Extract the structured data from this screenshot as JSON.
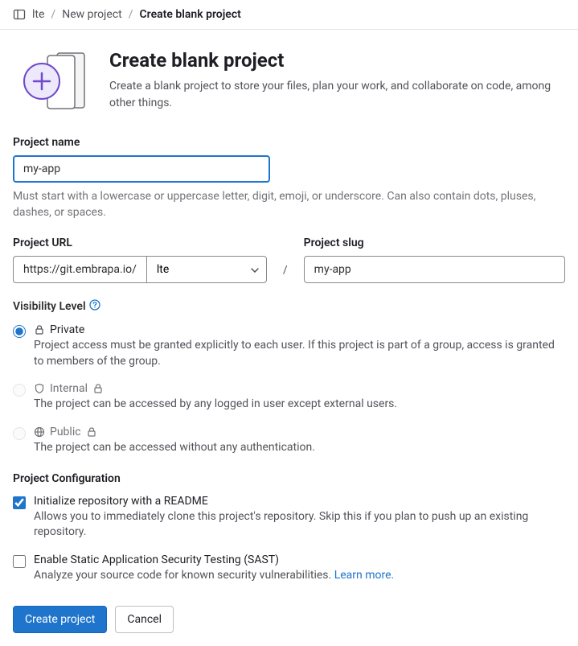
{
  "breadcrumb": {
    "items": [
      "lte",
      "New project",
      "Create blank project"
    ]
  },
  "header": {
    "title": "Create blank project",
    "description": "Create a blank project to store your files, plan your work, and collaborate on code, among other things."
  },
  "form": {
    "project_name": {
      "label": "Project name",
      "value": "my-app",
      "help": "Must start with a lowercase or uppercase letter, digit, emoji, or underscore. Can also contain dots, pluses, dashes, or spaces."
    },
    "project_url": {
      "label": "Project URL",
      "prefix": "https://git.embrapa.io/",
      "namespace": "lte",
      "separator": "/"
    },
    "project_slug": {
      "label": "Project slug",
      "value": "my-app"
    },
    "visibility": {
      "label": "Visibility Level",
      "options": [
        {
          "value": "private",
          "label": "Private",
          "desc": "Project access must be granted explicitly to each user. If this project is part of a group, access is granted to members of the group.",
          "selected": true,
          "disabled": false,
          "locked": false
        },
        {
          "value": "internal",
          "label": "Internal",
          "desc": "The project can be accessed by any logged in user except external users.",
          "selected": false,
          "disabled": true,
          "locked": true
        },
        {
          "value": "public",
          "label": "Public",
          "desc": "The project can be accessed without any authentication.",
          "selected": false,
          "disabled": true,
          "locked": true
        }
      ]
    },
    "config": {
      "label": "Project Configuration",
      "readme": {
        "label": "Initialize repository with a README",
        "desc": "Allows you to immediately clone this project's repository. Skip this if you plan to push up an existing repository.",
        "checked": true
      },
      "sast": {
        "label": "Enable Static Application Security Testing (SAST)",
        "desc_prefix": "Analyze your source code for known security vulnerabilities. ",
        "link_text": "Learn more.",
        "checked": false
      }
    },
    "buttons": {
      "submit": "Create project",
      "cancel": "Cancel"
    }
  }
}
